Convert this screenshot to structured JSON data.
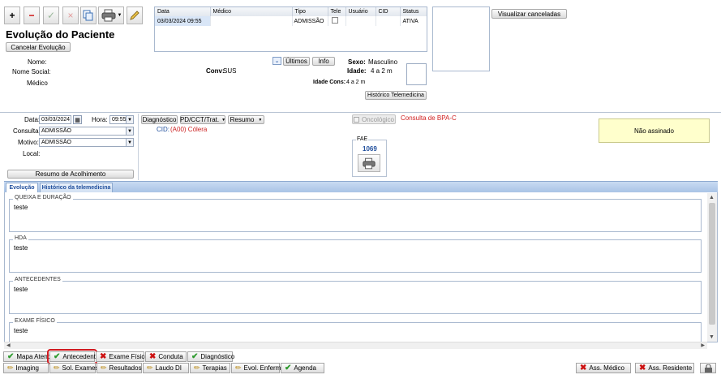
{
  "toolbar": {
    "add": "+",
    "remove": "−",
    "confirm": "✓",
    "cancel": "×"
  },
  "header": {
    "title": "Evolução do Paciente",
    "cancel_evolution": "Cancelar Evolução",
    "view_cancelled": "Visualizar canceladas"
  },
  "grid": {
    "columns": [
      "Data",
      "Médico",
      "Tipo",
      "Tele",
      "Usuário",
      "CID",
      "Status"
    ],
    "rows": [
      {
        "data": "03/03/2024 09:55",
        "medico": "",
        "tipo": "ADMISSÃO",
        "tele": "",
        "usuario": "",
        "cid": "",
        "status": "ATIVA"
      }
    ]
  },
  "patient": {
    "nome_label": "Nome:",
    "nome_social_label": "Nome Social:",
    "medico_label": "Médico",
    "conv_label": "Conv:",
    "conv_value": "SUS",
    "ultimos": "Últimos",
    "info": "Info",
    "sexo_label": "Sexo:",
    "sexo_value": "Masculino",
    "idade_label": "Idade:",
    "idade_value": "4 a 2 m",
    "idade_cons_label": "Idade Cons:",
    "idade_cons_value": "4 a 2 m",
    "historico_tele": "Histórico Telemedicina"
  },
  "form": {
    "data_label": "Data:",
    "data_value": "03/03/2024",
    "hora_label": "Hora:",
    "hora_value": "09:55",
    "consulta_label": "Consulta:",
    "consulta_value": "ADMISSÃO",
    "motivo_label": "Motivo:",
    "motivo_value": "ADMISSÃO",
    "local_label": "Local:",
    "resumo_acolhimento": "Resumo de Acolhimento",
    "diagnostico": "Diagnóstico",
    "pd_cct": "PD/CCT/Trat.",
    "resumo": "Resumo",
    "cid_label": "CID:",
    "cid_value": "(A00) Cólera",
    "oncologico": "Oncológico",
    "bpa": "Consulta de BPA-C",
    "fae_label": "FAE",
    "fae_number": "1069",
    "signature_status": "Não assinado"
  },
  "tabs": [
    {
      "label": "Evolução"
    },
    {
      "label": "Histórico da telemedicina"
    }
  ],
  "sections": [
    {
      "legend": "QUEIXA E DURAÇÃO",
      "text": "teste"
    },
    {
      "legend": "HDA",
      "text": "teste"
    },
    {
      "legend": "ANTECEDENTES",
      "text": "teste"
    },
    {
      "legend": "EXAME FÍSICO",
      "text": "teste"
    }
  ],
  "bottom_row1": [
    {
      "label": "Mapa Atend.",
      "icon": "check"
    },
    {
      "label": "Antecedentes",
      "icon": "check"
    },
    {
      "label": "Exame Físico",
      "icon": "x"
    },
    {
      "label": "Conduta",
      "icon": "x"
    },
    {
      "label": "Diagnóstico",
      "icon": "check"
    }
  ],
  "bottom_row2": [
    {
      "label": "Imaging",
      "icon": "pen"
    },
    {
      "label": "Sol. Exames",
      "icon": "pen"
    },
    {
      "label": "Resultados",
      "icon": "pen"
    },
    {
      "label": "Laudo DI",
      "icon": "pen"
    },
    {
      "label": "Terapias",
      "icon": "pen"
    },
    {
      "label": "Evol. Enferm.",
      "icon": "pen"
    },
    {
      "label": "Agenda",
      "icon": "check"
    }
  ],
  "sign": {
    "ass_medico": "Ass. Médico",
    "ass_residente": "Ass. Residente"
  },
  "colors": {
    "highlight": "#d0191f",
    "accent_blue": "#1f4e9c",
    "red_text": "#d02020",
    "yellow_box": "#ffffcc"
  }
}
